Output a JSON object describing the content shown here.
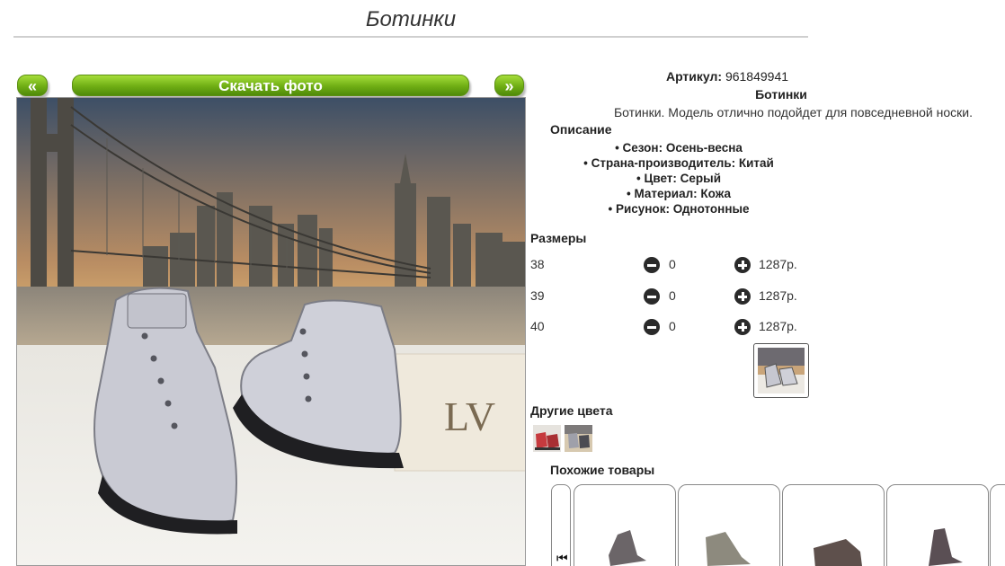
{
  "page": {
    "title": "Ботинки"
  },
  "nav": {
    "prev_label": "«",
    "download_label": "Скачать фото",
    "next_label": "»"
  },
  "product": {
    "article_label": "Артикул:",
    "article_value": "961849941",
    "name": "Ботинки",
    "description": "Ботинки. Модель отлично подойдет для повседневной носки.",
    "description_heading": "Описание",
    "attributes": [
      "Сезон: Осень-весна",
      "Страна-производитель: Китай",
      "Цвет: Серый",
      "Материал: Кожа",
      "Рисунок: Однотонные"
    ]
  },
  "sizes": {
    "heading": "Размеры",
    "rows": [
      {
        "size": "38",
        "qty": "0",
        "price": "1287р."
      },
      {
        "size": "39",
        "qty": "0",
        "price": "1287р."
      },
      {
        "size": "40",
        "qty": "0",
        "price": "1287р."
      }
    ]
  },
  "other_colors": {
    "heading": "Другие цвета"
  },
  "similar": {
    "heading": "Похожие товары"
  },
  "colors": {
    "button_green": "#6fae14",
    "border_gray": "#888888"
  }
}
